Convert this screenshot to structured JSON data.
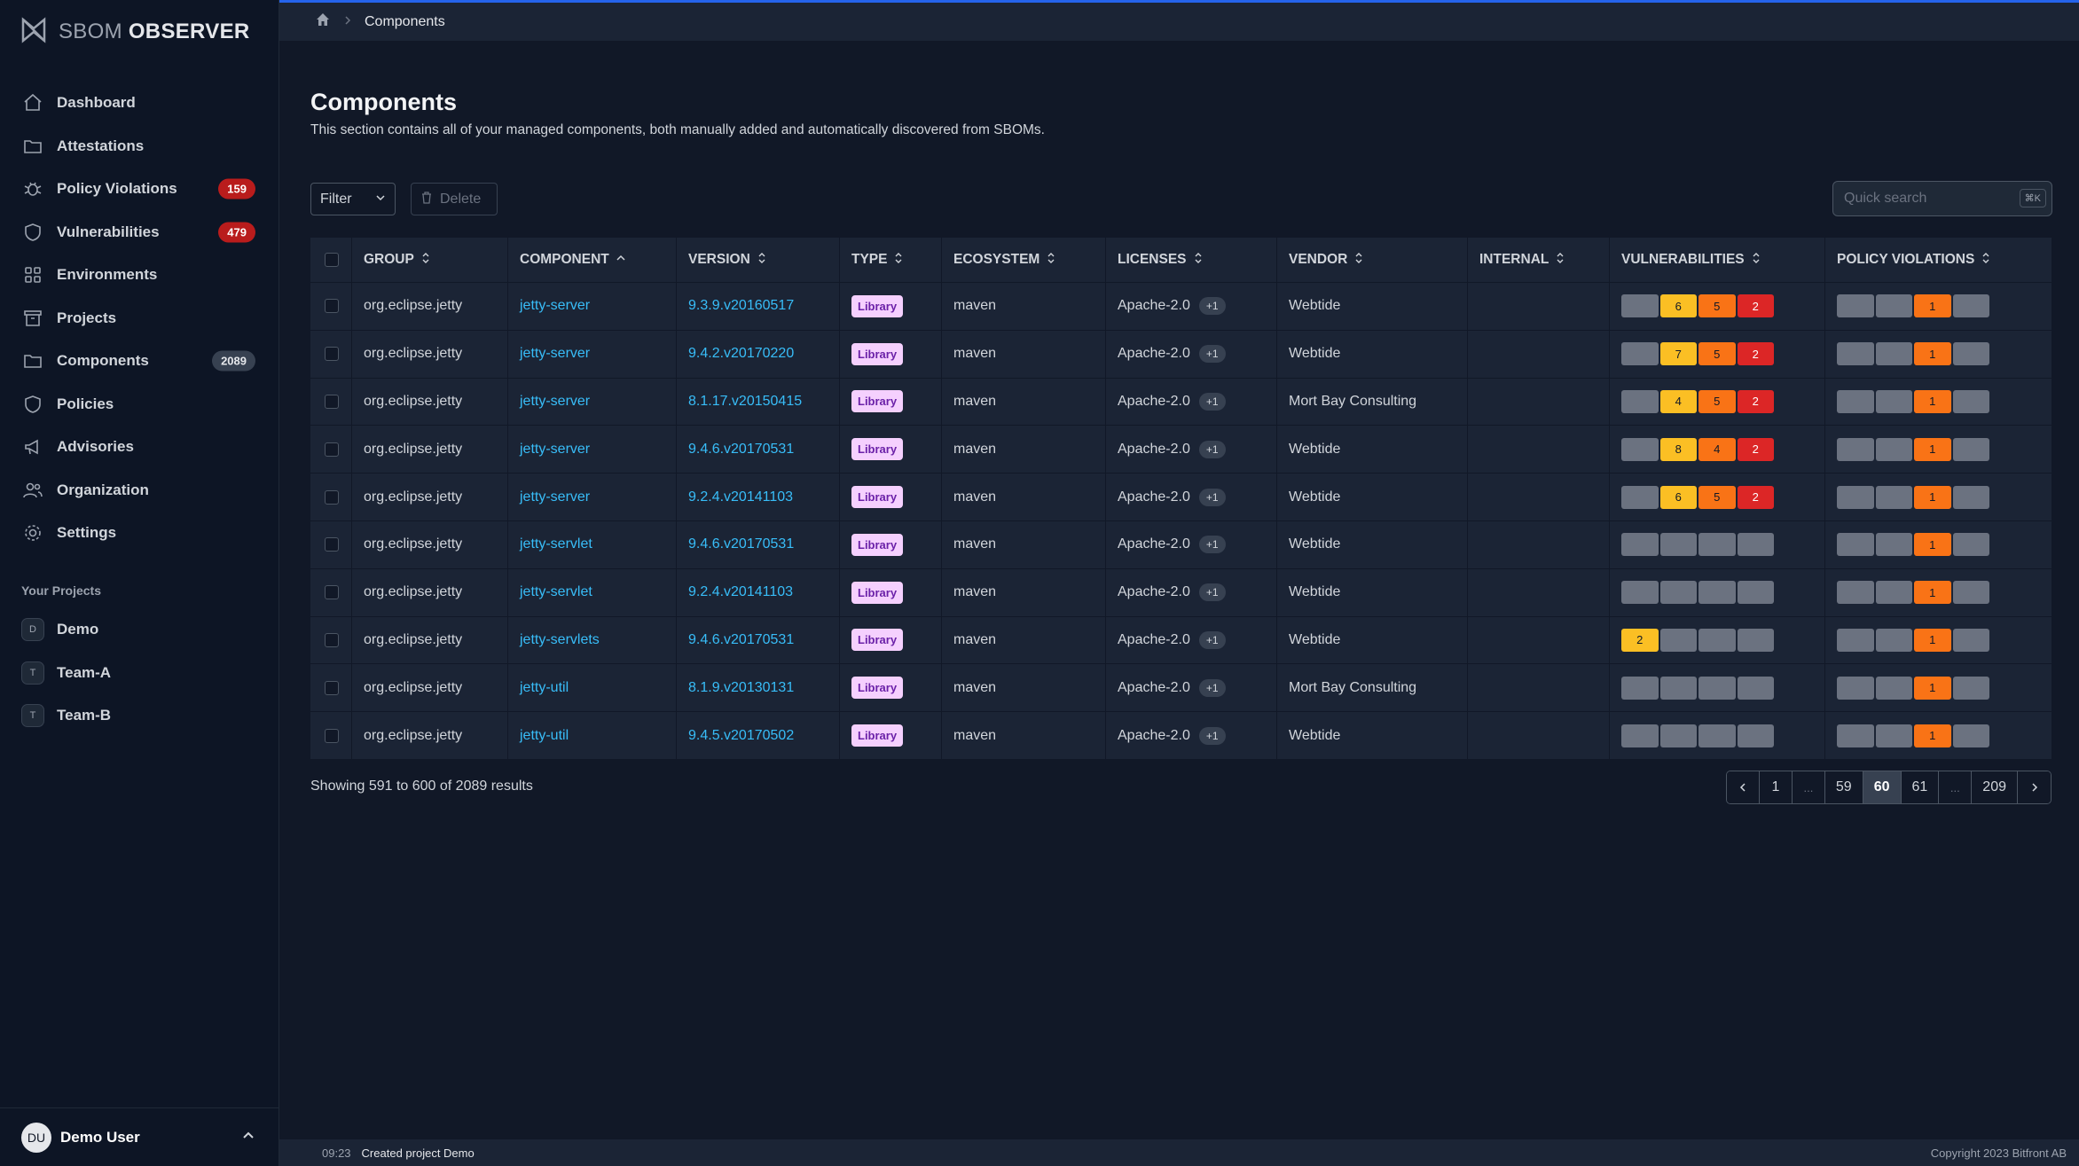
{
  "app": {
    "logo_light": "SBOM ",
    "logo_bold": "OBSERVER"
  },
  "sidebar": {
    "items": [
      {
        "label": "Dashboard",
        "icon": "home-icon"
      },
      {
        "label": "Attestations",
        "icon": "folder-icon"
      },
      {
        "label": "Policy Violations",
        "icon": "bug-icon",
        "badge": "159"
      },
      {
        "label": "Vulnerabilities",
        "icon": "shield-icon",
        "badge": "479"
      },
      {
        "label": "Environments",
        "icon": "grid-icon"
      },
      {
        "label": "Projects",
        "icon": "archive-icon"
      },
      {
        "label": "Components",
        "icon": "folder-icon",
        "badge": "2089"
      },
      {
        "label": "Policies",
        "icon": "shield-icon"
      },
      {
        "label": "Advisories",
        "icon": "megaphone-icon"
      },
      {
        "label": "Organization",
        "icon": "users-icon"
      },
      {
        "label": "Settings",
        "icon": "gear-icon"
      }
    ],
    "projects_title": "Your Projects",
    "projects": [
      {
        "initial": "D",
        "label": "Demo"
      },
      {
        "initial": "T",
        "label": "Team-A"
      },
      {
        "initial": "T",
        "label": "Team-B"
      }
    ],
    "user": {
      "initials": "DU",
      "name": "Demo User"
    }
  },
  "breadcrumb": {
    "current": "Components"
  },
  "page": {
    "title": "Components",
    "description": "This section contains all of your managed components, both manually added and automatically discovered from SBOMs."
  },
  "toolbar": {
    "filter_label": "Filter",
    "delete_label": "Delete",
    "search_placeholder": "Quick search",
    "search_shortcut": "⌘K"
  },
  "table": {
    "columns": [
      "GROUP",
      "COMPONENT",
      "VERSION",
      "TYPE",
      "ECOSYSTEM",
      "LICENSES",
      "VENDOR",
      "INTERNAL",
      "VULNERABILITIES",
      "POLICY VIOLATIONS"
    ],
    "rows": [
      {
        "group": "org.eclipse.jetty",
        "component": "jetty-server",
        "version": "9.3.9.v20160517",
        "type": "Library",
        "ecosystem": "maven",
        "license": "Apache-2.0",
        "license_more": "+1",
        "vendor": "Webtide",
        "internal": "",
        "vulns": [
          "",
          "6",
          "5",
          "2"
        ],
        "violations": [
          "",
          "",
          "1",
          ""
        ]
      },
      {
        "group": "org.eclipse.jetty",
        "component": "jetty-server",
        "version": "9.4.2.v20170220",
        "type": "Library",
        "ecosystem": "maven",
        "license": "Apache-2.0",
        "license_more": "+1",
        "vendor": "Webtide",
        "internal": "",
        "vulns": [
          "",
          "7",
          "5",
          "2"
        ],
        "violations": [
          "",
          "",
          "1",
          ""
        ]
      },
      {
        "group": "org.eclipse.jetty",
        "component": "jetty-server",
        "version": "8.1.17.v20150415",
        "type": "Library",
        "ecosystem": "maven",
        "license": "Apache-2.0",
        "license_more": "+1",
        "vendor": "Mort Bay Consulting",
        "internal": "",
        "vulns": [
          "",
          "4",
          "5",
          "2"
        ],
        "violations": [
          "",
          "",
          "1",
          ""
        ]
      },
      {
        "group": "org.eclipse.jetty",
        "component": "jetty-server",
        "version": "9.4.6.v20170531",
        "type": "Library",
        "ecosystem": "maven",
        "license": "Apache-2.0",
        "license_more": "+1",
        "vendor": "Webtide",
        "internal": "",
        "vulns": [
          "",
          "8",
          "4",
          "2"
        ],
        "violations": [
          "",
          "",
          "1",
          ""
        ]
      },
      {
        "group": "org.eclipse.jetty",
        "component": "jetty-server",
        "version": "9.2.4.v20141103",
        "type": "Library",
        "ecosystem": "maven",
        "license": "Apache-2.0",
        "license_more": "+1",
        "vendor": "Webtide",
        "internal": "",
        "vulns": [
          "",
          "6",
          "5",
          "2"
        ],
        "violations": [
          "",
          "",
          "1",
          ""
        ]
      },
      {
        "group": "org.eclipse.jetty",
        "component": "jetty-servlet",
        "version": "9.4.6.v20170531",
        "type": "Library",
        "ecosystem": "maven",
        "license": "Apache-2.0",
        "license_more": "+1",
        "vendor": "Webtide",
        "internal": "",
        "vulns": [
          "",
          "",
          "",
          ""
        ],
        "violations": [
          "",
          "",
          "1",
          ""
        ]
      },
      {
        "group": "org.eclipse.jetty",
        "component": "jetty-servlet",
        "version": "9.2.4.v20141103",
        "type": "Library",
        "ecosystem": "maven",
        "license": "Apache-2.0",
        "license_more": "+1",
        "vendor": "Webtide",
        "internal": "",
        "vulns": [
          "",
          "",
          "",
          ""
        ],
        "violations": [
          "",
          "",
          "1",
          ""
        ]
      },
      {
        "group": "org.eclipse.jetty",
        "component": "jetty-servlets",
        "version": "9.4.6.v20170531",
        "type": "Library",
        "ecosystem": "maven",
        "license": "Apache-2.0",
        "license_more": "+1",
        "vendor": "Webtide",
        "internal": "",
        "vulns": [
          "2",
          "",
          "",
          ""
        ],
        "violations": [
          "",
          "",
          "1",
          ""
        ]
      },
      {
        "group": "org.eclipse.jetty",
        "component": "jetty-util",
        "version": "8.1.9.v20130131",
        "type": "Library",
        "ecosystem": "maven",
        "license": "Apache-2.0",
        "license_more": "+1",
        "vendor": "Mort Bay Consulting",
        "internal": "",
        "vulns": [
          "",
          "",
          "",
          ""
        ],
        "violations": [
          "",
          "",
          "1",
          ""
        ]
      },
      {
        "group": "org.eclipse.jetty",
        "component": "jetty-util",
        "version": "9.4.5.v20170502",
        "type": "Library",
        "ecosystem": "maven",
        "license": "Apache-2.0",
        "license_more": "+1",
        "vendor": "Webtide",
        "internal": "",
        "vulns": [
          "",
          "",
          "",
          ""
        ],
        "violations": [
          "",
          "",
          "1",
          ""
        ]
      }
    ]
  },
  "results": {
    "showing": "Showing 591 to 600 of 2089 results"
  },
  "pagination": {
    "pages": [
      "1",
      "...",
      "59",
      "60",
      "61",
      "...",
      "209"
    ],
    "active": "60"
  },
  "footer": {
    "time": "09:23",
    "message": "Created project Demo",
    "copyright": "Copyright 2023 Bitfront AB"
  },
  "colors": {
    "accent": "#38bdf8",
    "danger": "#dc2626",
    "warning": "#f97316",
    "caution": "#fbbf24",
    "sidebar_bg": "#0d1525"
  }
}
